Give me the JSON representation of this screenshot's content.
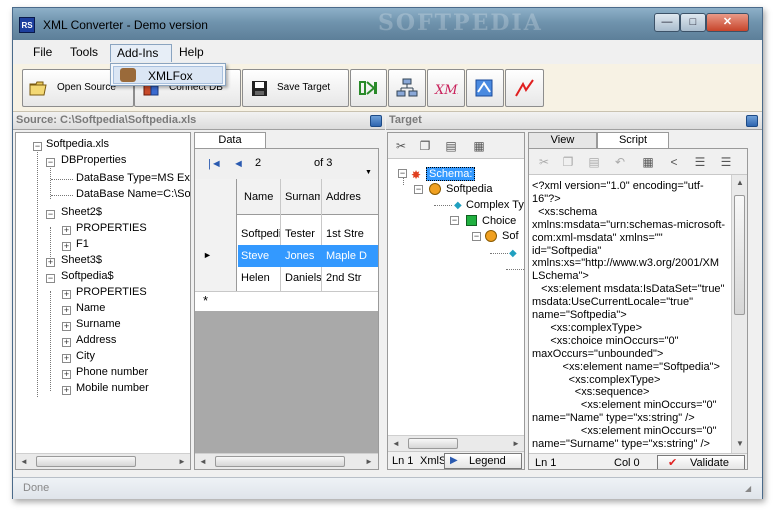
{
  "window": {
    "title": "XML Converter - Demo version",
    "icon_text": "RS",
    "watermark": "SOFTPEDIA"
  },
  "window_controls": {
    "minimize": "—",
    "maximize": "□",
    "close": "✕"
  },
  "menu": {
    "file": "File",
    "tools": "Tools",
    "addins": "Add-Ins",
    "help": "Help"
  },
  "dropdown": {
    "item": "XMLFox"
  },
  "toolbar": {
    "open_source": "Open Source",
    "connect_db": "Connect DB",
    "save_target": "Save Target"
  },
  "source_header": "Source: C:\\Softpedia\\Softpedia.xls",
  "target_header": "Target",
  "source_tree": {
    "root": "Softpedia.xls",
    "dbproperties": "DBProperties",
    "db_type": "DataBase Type=MS Exc",
    "db_name": "DataBase Name=C:\\Sof",
    "sheet2": "Sheet2$",
    "properties": "PROPERTIES",
    "f1": "F1",
    "sheet3": "Sheet3$",
    "softpedia": "Softpedia$",
    "properties2": "PROPERTIES",
    "name": "Name",
    "surname": "Surname",
    "address": "Address",
    "city": "City",
    "phone": "Phone number",
    "mobile": "Mobile number"
  },
  "data_panel": {
    "tab": "Data",
    "record": "2",
    "of": "of 3",
    "columns": [
      "Name",
      "Surnam",
      "Addres"
    ],
    "rows": [
      [
        "Softpedia",
        "Tester",
        "1st Stre"
      ],
      [
        "Steve",
        "Jones",
        "Maple D"
      ],
      [
        "Helen",
        "Daniels",
        "2nd Str"
      ]
    ],
    "new_row_marker": "*"
  },
  "schema_tree": {
    "schema": "Schema:",
    "softpedia": "Softpedia",
    "complex": "Complex Ty",
    "choice": "Choice",
    "sof": "Sof"
  },
  "schema_status": {
    "ln": "Ln 1",
    "xml": "XmlS",
    "legend": "Legend"
  },
  "script_tabs": {
    "view": "View",
    "script": "Script"
  },
  "script_lines": [
    "<?xml version=\"1.0\" encoding=\"utf-",
    "16\"?>",
    "  <xs:schema",
    "xmlns:msdata=\"urn:schemas-microsoft-",
    "com:xml-msdata\" xmlns=\"\"",
    "id=\"Softpedia\"",
    "xmlns:xs=\"http://www.w3.org/2001/XM",
    "LSchema\">",
    "   <xs:element msdata:IsDataSet=\"true\"",
    "msdata:UseCurrentLocale=\"true\"",
    "name=\"Softpedia\">",
    "      <xs:complexType>",
    "      <xs:choice minOccurs=\"0\"",
    "maxOccurs=\"unbounded\">",
    "          <xs:element name=\"Softpedia\">",
    "            <xs:complexType>",
    "              <xs:sequence>",
    "                <xs:element minOccurs=\"0\"",
    "name=\"Name\" type=\"xs:string\" />",
    "                <xs:element minOccurs=\"0\"",
    "name=\"Surname\" type=\"xs:string\" />"
  ],
  "script_status": {
    "ln": "Ln 1",
    "col": "Col 0",
    "validate": "Validate"
  },
  "status": {
    "text": "Done"
  }
}
